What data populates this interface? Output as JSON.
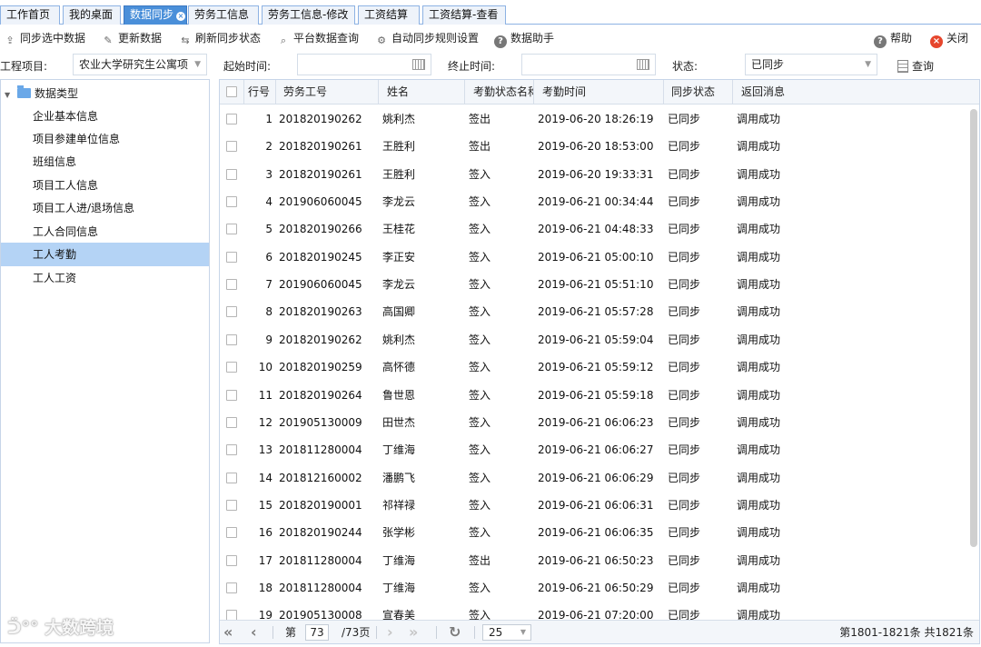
{
  "tabs": [
    {
      "label": "工作首页"
    },
    {
      "label": "我的桌面"
    },
    {
      "label": "数据同步",
      "active": true
    },
    {
      "label": "劳务工信息"
    },
    {
      "label": "劳务工信息-修改"
    },
    {
      "label": "工资结算"
    },
    {
      "label": "工资结算-查看"
    }
  ],
  "toolbar": {
    "sync_selected": "同步选中数据",
    "update_data": "更新数据",
    "refresh_status": "刷新同步状态",
    "platform_query": "平台数据查询",
    "auto_sync_rules": "自动同步规则设置",
    "data_assistant": "数据助手",
    "help": "帮助",
    "close": "关闭"
  },
  "filters": {
    "project_label": "工程项目:",
    "project_value": "农业大学研究生公寓项",
    "start_label": "起始时间:",
    "start_value": "",
    "end_label": "终止时间:",
    "end_value": "",
    "status_label": "状态:",
    "status_value": "已同步",
    "query_label": "查询"
  },
  "tree": {
    "root": "数据类型",
    "items": [
      "企业基本信息",
      "项目参建单位信息",
      "班组信息",
      "项目工人信息",
      "项目工人进/退场信息",
      "工人合同信息",
      "工人考勤",
      "工人工资"
    ],
    "selected_index": 6
  },
  "grid": {
    "columns": [
      "行号",
      "劳务工号",
      "姓名",
      "考勤状态名称",
      "考勤时间",
      "同步状态",
      "返回消息"
    ],
    "rows": [
      [
        "1",
        "201820190262",
        "姚利杰",
        "签出",
        "2019-06-20 18:26:19",
        "已同步",
        "调用成功"
      ],
      [
        "2",
        "201820190261",
        "王胜利",
        "签出",
        "2019-06-20 18:53:00",
        "已同步",
        "调用成功"
      ],
      [
        "3",
        "201820190261",
        "王胜利",
        "签入",
        "2019-06-20 19:33:31",
        "已同步",
        "调用成功"
      ],
      [
        "4",
        "201906060045",
        "李龙云",
        "签入",
        "2019-06-21 00:34:44",
        "已同步",
        "调用成功"
      ],
      [
        "5",
        "201820190266",
        "王桂花",
        "签入",
        "2019-06-21 04:48:33",
        "已同步",
        "调用成功"
      ],
      [
        "6",
        "201820190245",
        "李正安",
        "签入",
        "2019-06-21 05:00:10",
        "已同步",
        "调用成功"
      ],
      [
        "7",
        "201906060045",
        "李龙云",
        "签入",
        "2019-06-21 05:51:10",
        "已同步",
        "调用成功"
      ],
      [
        "8",
        "201820190263",
        "高国卿",
        "签入",
        "2019-06-21 05:57:28",
        "已同步",
        "调用成功"
      ],
      [
        "9",
        "201820190262",
        "姚利杰",
        "签入",
        "2019-06-21 05:59:04",
        "已同步",
        "调用成功"
      ],
      [
        "10",
        "201820190259",
        "高怀德",
        "签入",
        "2019-06-21 05:59:12",
        "已同步",
        "调用成功"
      ],
      [
        "11",
        "201820190264",
        "鲁世恩",
        "签入",
        "2019-06-21 05:59:18",
        "已同步",
        "调用成功"
      ],
      [
        "12",
        "201905130009",
        "田世杰",
        "签入",
        "2019-06-21 06:06:23",
        "已同步",
        "调用成功"
      ],
      [
        "13",
        "201811280004",
        "丁维海",
        "签入",
        "2019-06-21 06:06:27",
        "已同步",
        "调用成功"
      ],
      [
        "14",
        "201812160002",
        "潘鹏飞",
        "签入",
        "2019-06-21 06:06:29",
        "已同步",
        "调用成功"
      ],
      [
        "15",
        "201820190001",
        "祁祥禄",
        "签入",
        "2019-06-21 06:06:31",
        "已同步",
        "调用成功"
      ],
      [
        "16",
        "201820190244",
        "张学彬",
        "签入",
        "2019-06-21 06:06:35",
        "已同步",
        "调用成功"
      ],
      [
        "17",
        "201811280004",
        "丁维海",
        "签出",
        "2019-06-21 06:50:23",
        "已同步",
        "调用成功"
      ],
      [
        "18",
        "201811280004",
        "丁维海",
        "签入",
        "2019-06-21 06:50:29",
        "已同步",
        "调用成功"
      ],
      [
        "19",
        "201905130008",
        "宣春美",
        "签入",
        "2019-06-21 07:20:00",
        "已同步",
        "调用成功"
      ]
    ]
  },
  "pager": {
    "page_prefix": "第",
    "page_value": "73",
    "page_total": "/73页",
    "page_size": "25",
    "summary": "第1801-1821条 共1821条"
  },
  "watermark": "大数跨境",
  "colors": {
    "active_tab": "#4a8fd9",
    "selected_row": "#b4d3f5",
    "border": "#c7d5e8"
  }
}
